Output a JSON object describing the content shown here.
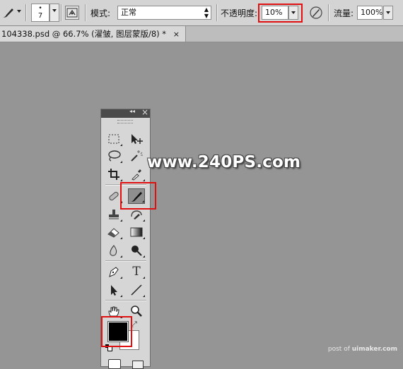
{
  "options_bar": {
    "brush_size": "7",
    "mode_label": "模式:",
    "mode_value": "正常",
    "opacity_label": "不透明度:",
    "opacity_value": "10%",
    "flow_label": "流量:",
    "flow_value": "100%"
  },
  "document_tab": {
    "title": "104338.psd @ 66.7% (濯皱, 图层蒙版/8) *",
    "close_glyph": "×"
  },
  "toolbox": {
    "collapse_glyph": "◂◂",
    "close_glyph": "×",
    "tools": [
      {
        "name": "rectangular-marquee",
        "icon": "dashed-rect-icon"
      },
      {
        "name": "move",
        "icon": "move-icon"
      },
      {
        "name": "lasso",
        "icon": "lasso-icon"
      },
      {
        "name": "magic-wand",
        "icon": "magic-wand-icon"
      },
      {
        "name": "crop",
        "icon": "crop-icon"
      },
      {
        "name": "eyedropper",
        "icon": "eyedropper-icon"
      },
      {
        "name": "healing-brush",
        "icon": "bandage-icon"
      },
      {
        "name": "brush",
        "icon": "brush-icon",
        "active": true
      },
      {
        "name": "clone-stamp",
        "icon": "stamp-icon"
      },
      {
        "name": "history-brush",
        "icon": "history-brush-icon"
      },
      {
        "name": "eraser",
        "icon": "eraser-icon"
      },
      {
        "name": "gradient",
        "icon": "gradient-icon"
      },
      {
        "name": "blur",
        "icon": "blur-drop-icon"
      },
      {
        "name": "dodge",
        "icon": "dodge-icon"
      },
      {
        "name": "pen",
        "icon": "pen-icon"
      },
      {
        "name": "type",
        "icon": "type-icon"
      },
      {
        "name": "path-selection",
        "icon": "arrow-icon"
      },
      {
        "name": "line",
        "icon": "line-icon"
      },
      {
        "name": "hand",
        "icon": "hand-icon"
      },
      {
        "name": "zoom",
        "icon": "zoom-icon"
      }
    ],
    "type_glyph": "T",
    "foreground_color": "#000000",
    "background_color": "#ffffff"
  },
  "watermark": "www.240PS.com",
  "credit": {
    "prefix": "post of ",
    "site": "uimaker.com"
  },
  "colors": {
    "highlight": "#e01010",
    "canvas": "#959595"
  }
}
